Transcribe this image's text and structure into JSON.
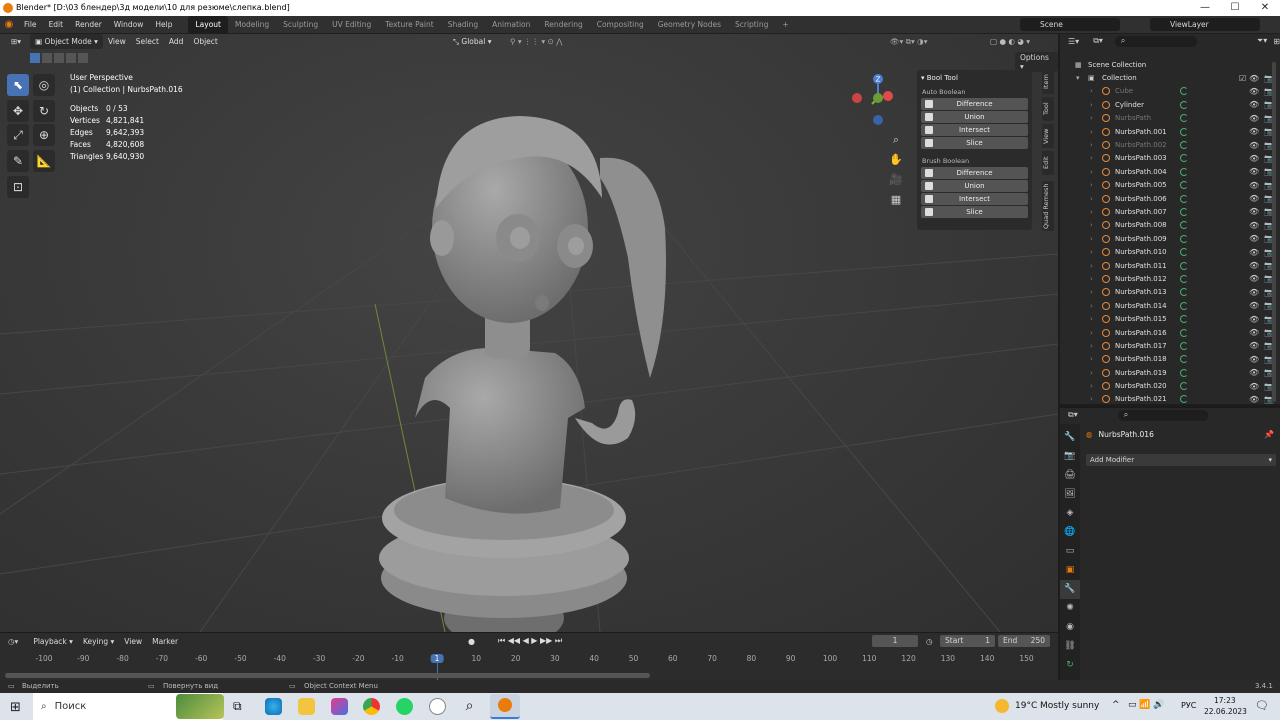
{
  "window": {
    "title": "Blender* [D:\\03 блендер\\3д модели\\10 для резюме\\слепка.blend]",
    "min": "—",
    "max": "☐",
    "close": "✕"
  },
  "menubar": {
    "menus": [
      "File",
      "Edit",
      "Render",
      "Window",
      "Help"
    ],
    "workspaces": [
      "Layout",
      "Modeling",
      "Sculpting",
      "UV Editing",
      "Texture Paint",
      "Shading",
      "Animation",
      "Rendering",
      "Compositing",
      "Geometry Nodes",
      "Scripting"
    ],
    "active_workspace_index": 0,
    "add_tab": "+",
    "scene": "Scene",
    "view_layer": "ViewLayer"
  },
  "viewport": {
    "header": {
      "mode": "Object Mode",
      "menus": [
        "View",
        "Select",
        "Add",
        "Object"
      ],
      "orientation": "Global",
      "options": "Options"
    },
    "overlay_text": {
      "perspective": "User Perspective",
      "collection": "(1) Collection | NurbsPath.016"
    },
    "stats": [
      {
        "label": "Objects",
        "value": "0 / 53"
      },
      {
        "label": "Vertices",
        "value": "4,821,841"
      },
      {
        "label": "Edges",
        "value": "9,642,393"
      },
      {
        "label": "Faces",
        "value": "4,820,608"
      },
      {
        "label": "Triangles",
        "value": "9,640,930"
      }
    ],
    "gizmo": {
      "x": "X",
      "y": "Y",
      "z": "Z"
    }
  },
  "booltool": {
    "title": "Bool Tool",
    "auto": {
      "title": "Auto Boolean",
      "buttons": [
        "Difference",
        "Union",
        "Intersect",
        "Slice"
      ]
    },
    "brush": {
      "title": "Brush Boolean",
      "buttons": [
        "Difference",
        "Union",
        "Intersect",
        "Slice"
      ]
    },
    "tabs": [
      "Item",
      "Tool",
      "View",
      "Edit",
      "Quad Remesh"
    ]
  },
  "timeline": {
    "menus": [
      "Playback",
      "Keying",
      "View",
      "Marker"
    ],
    "current_frame": "1",
    "start_label": "Start",
    "start": "1",
    "end_label": "End",
    "end": "250",
    "ticks": [
      "-100",
      "-90",
      "-80",
      "-70",
      "-60",
      "-50",
      "-40",
      "-30",
      "-20",
      "-10",
      "1",
      "10",
      "20",
      "30",
      "40",
      "50",
      "60",
      "70",
      "80",
      "90",
      "100",
      "110",
      "120",
      "130",
      "140",
      "150"
    ]
  },
  "outliner": {
    "root": "Scene Collection",
    "collection": "Collection",
    "items": [
      {
        "name": "Cube",
        "dim": true
      },
      {
        "name": "Cylinder",
        "dim": false
      },
      {
        "name": "NurbsPath",
        "dim": true
      },
      {
        "name": "NurbsPath.001",
        "dim": false
      },
      {
        "name": "NurbsPath.002",
        "dim": true
      },
      {
        "name": "NurbsPath.003",
        "dim": false
      },
      {
        "name": "NurbsPath.004",
        "dim": false
      },
      {
        "name": "NurbsPath.005",
        "dim": false
      },
      {
        "name": "NurbsPath.006",
        "dim": false
      },
      {
        "name": "NurbsPath.007",
        "dim": false
      },
      {
        "name": "NurbsPath.008",
        "dim": false
      },
      {
        "name": "NurbsPath.009",
        "dim": false
      },
      {
        "name": "NurbsPath.010",
        "dim": false
      },
      {
        "name": "NurbsPath.011",
        "dim": false
      },
      {
        "name": "NurbsPath.012",
        "dim": false
      },
      {
        "name": "NurbsPath.013",
        "dim": false
      },
      {
        "name": "NurbsPath.014",
        "dim": false
      },
      {
        "name": "NurbsPath.015",
        "dim": false
      },
      {
        "name": "NurbsPath.016",
        "dim": false
      },
      {
        "name": "NurbsPath.017",
        "dim": false
      },
      {
        "name": "NurbsPath.018",
        "dim": false
      },
      {
        "name": "NurbsPath.019",
        "dim": false
      },
      {
        "name": "NurbsPath.020",
        "dim": false
      },
      {
        "name": "NurbsPath.021",
        "dim": false
      }
    ]
  },
  "properties": {
    "object": "NurbsPath.016",
    "add_modifier": "Add Modifier"
  },
  "status": {
    "select": "Выделить",
    "rotate": "Повернуть вид",
    "context": "Object Context Menu",
    "version": "3.4.1"
  },
  "taskbar": {
    "search": "Поиск",
    "weather_temp": "19°C",
    "weather": "Mostly sunny",
    "lang": "РУС",
    "time": "17:23",
    "date": "22.06.2023",
    "chevron": "^"
  },
  "colors": {
    "accent": "#4772b3",
    "orange": "#e87d0d",
    "frame": "#4772b3"
  }
}
